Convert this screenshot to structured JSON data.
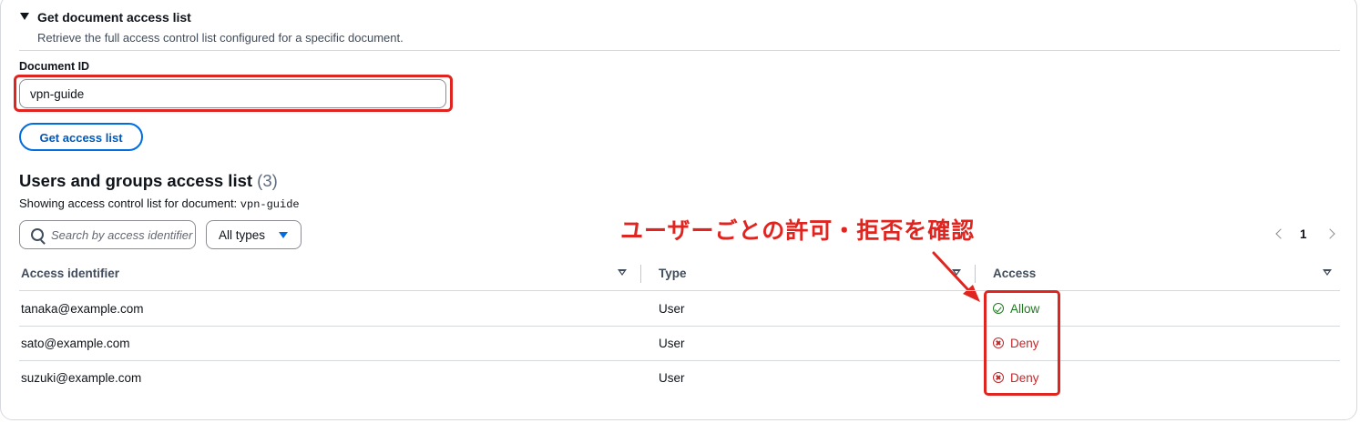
{
  "section": {
    "title": "Get document access list",
    "description": "Retrieve the full access control list configured for a specific document."
  },
  "document_field": {
    "label": "Document ID",
    "value": "vpn-guide"
  },
  "get_button_label": "Get access list",
  "list": {
    "title": "Users and groups access list",
    "count": "(3)",
    "desc_prefix": "Showing access control list for document:",
    "desc_doc": "vpn-guide"
  },
  "search": {
    "placeholder": "Search by access identifier"
  },
  "type_filter": {
    "selected": "All types"
  },
  "pagination": {
    "current_page": "1"
  },
  "annotation": "ユーザーごとの許可・拒否を確認",
  "table": {
    "headers": [
      "Access identifier",
      "Type",
      "Access"
    ],
    "rows": [
      {
        "identifier": "tanaka@example.com",
        "type": "User",
        "access": "Allow"
      },
      {
        "identifier": "sato@example.com",
        "type": "User",
        "access": "Deny"
      },
      {
        "identifier": "suzuki@example.com",
        "type": "User",
        "access": "Deny"
      }
    ]
  },
  "colors": {
    "accent": "#006ce0",
    "allow": "#1f7a1f",
    "deny": "#c0282a",
    "annotation": "#e0241f"
  },
  "icons": [
    "caret-down-icon",
    "search-icon",
    "dropdown-triangle-icon",
    "chevron-left-icon",
    "chevron-right-icon",
    "sort-icon",
    "check-circle-icon",
    "x-circle-icon",
    "arrow-icon"
  ]
}
